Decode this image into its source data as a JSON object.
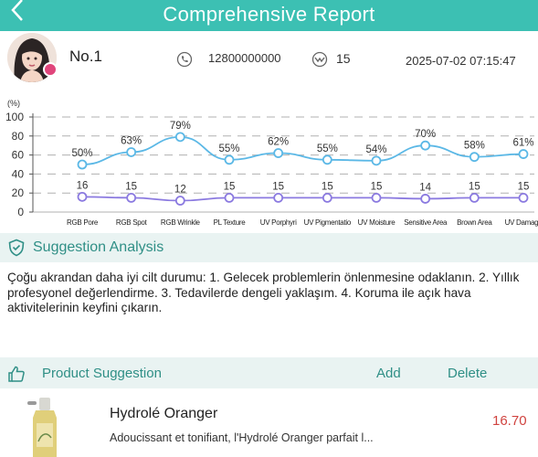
{
  "header": {
    "title": "Comprehensive Report"
  },
  "profile": {
    "name": "No.1",
    "phone": "12800000000",
    "age": "15",
    "datetime": "2025-07-02 07:15:47"
  },
  "chart_data": {
    "type": "line",
    "yunit": "(%)",
    "ylim": [
      0,
      100
    ],
    "yticks": [
      0,
      20,
      40,
      60,
      80,
      100
    ],
    "grid": true,
    "categories": [
      "RGB Pore",
      "RGB Spot",
      "RGB Wrinkle",
      "PL Texture",
      "UV Porphyrin",
      "UV Pigmentation",
      "UV Moisture",
      "Sensitive Area",
      "Brown Area",
      "UV Damage"
    ],
    "category_labels": [
      "RGB Pore",
      "RGB Spot",
      "RGB Wrinkle",
      "PL Texture",
      "UV Porphyri",
      "UV Pigmentatio",
      "UV Moisture",
      "Sensitive Area",
      "Brown Area",
      "UV Damage"
    ],
    "series": [
      {
        "values": [
          50,
          63,
          79,
          55,
          62,
          55,
          54,
          70,
          58,
          61
        ],
        "labels": [
          "50%",
          "63%",
          "79%",
          "55%",
          "62%",
          "55%",
          "54%",
          "70%",
          "58%",
          "61%"
        ],
        "color": "#5bb8e6"
      },
      {
        "values": [
          16,
          15,
          12,
          15,
          15,
          15,
          15,
          14,
          15,
          15
        ],
        "labels": [
          "16",
          "15",
          "12",
          "15",
          "15",
          "15",
          "15",
          "14",
          "15",
          "15"
        ],
        "color": "#8b7ae0"
      }
    ]
  },
  "suggestion": {
    "title": "Suggestion Analysis",
    "text": "Çoğu akrandan daha iyi cilt durumu: 1. Gelecek problemlerin önlenmesine odaklanın. 2. Yıllık profesyonel değerlendirme. 3. Tedavilerde dengeli yaklaşım. 4. Koruma ile açık hava aktivitelerinin keyfini çıkarın."
  },
  "product_section": {
    "title": "Product Suggestion",
    "add_label": "Add",
    "delete_label": "Delete"
  },
  "products": [
    {
      "name": "Hydrolé Oranger",
      "description": "Adoucissant et tonifiant, l'Hydrolé Oranger parfait l...",
      "price": "16.70"
    }
  ],
  "colors": {
    "accent": "#3cc0b3",
    "accent_text": "#2f8f86",
    "price": "#d0433f",
    "section_bg": "#e9f3f2"
  }
}
